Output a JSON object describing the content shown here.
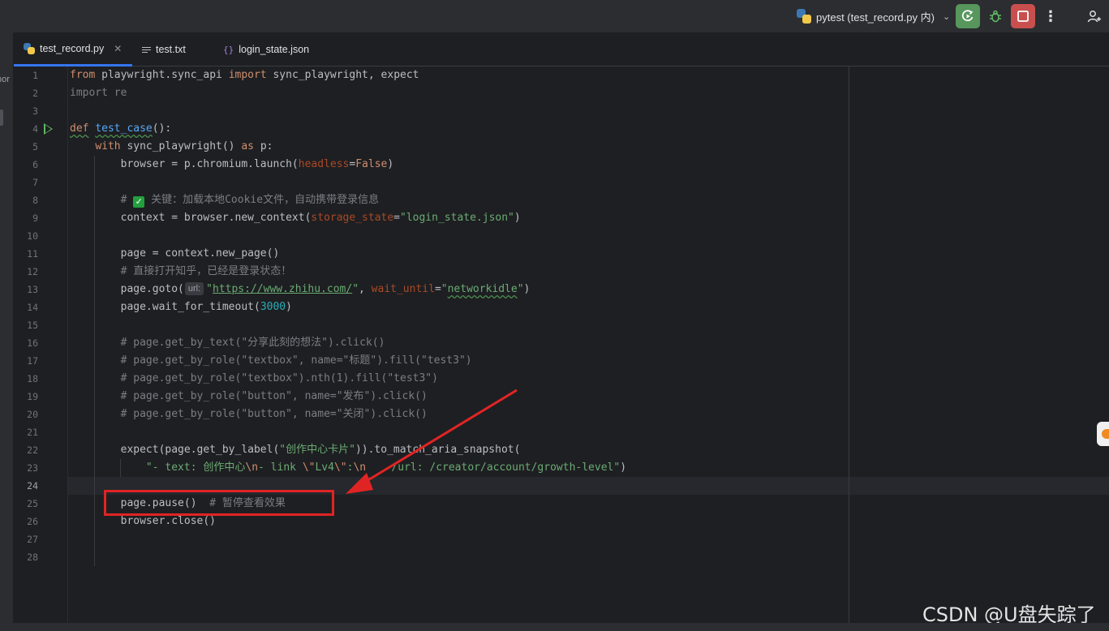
{
  "toolbar": {
    "run_config": "pytest (test_record.py 内)",
    "colors": {
      "run": "#57965c",
      "stop": "#c94f4f"
    }
  },
  "left_strip": {
    "cut_label": "nor"
  },
  "tabs": [
    {
      "label": "test_record.py",
      "active": true,
      "icon": "python-icon",
      "closable": true
    },
    {
      "label": "test.txt",
      "active": false,
      "icon": "text-file-icon"
    },
    {
      "label": "login_state.json",
      "active": false,
      "icon": "json-file-icon"
    }
  ],
  "editor": {
    "current_line": 24,
    "line_numbers": [
      "1",
      "2",
      "3",
      "4",
      "5",
      "6",
      "7",
      "8",
      "9",
      "10",
      "11",
      "12",
      "13",
      "14",
      "15",
      "16",
      "17",
      "18",
      "19",
      "20",
      "21",
      "22",
      "23",
      "24",
      "25",
      "26",
      "27",
      "28"
    ],
    "code": {
      "l1": {
        "kw1": "from",
        "mod": " playwright.sync_api ",
        "kw2": "import",
        "rest": " sync_playwright, expect"
      },
      "l2": {
        "text": "import re"
      },
      "l4": {
        "kw": "def",
        "sp": " ",
        "name": "test_case",
        "rest": "():"
      },
      "l5": {
        "indent": "    ",
        "kw": "with",
        "mid": " sync_playwright() ",
        "kw2": "as",
        "rest": " p:"
      },
      "l6": {
        "pre": "        browser = p.chromium.launch(",
        "param": "headless",
        "eq": "=",
        "val": "False",
        "post": ")"
      },
      "l8": {
        "pre": "        # ",
        "check": "✓",
        "post": " 关键：加载本地Cookie文件，自动携带登录信息"
      },
      "l9": {
        "pre": "        context = browser.new_context(",
        "param": "storage_state",
        "eq": "=",
        "str": "\"login_state.json\"",
        "post": ")"
      },
      "l11": {
        "text": "        page = context.new_page()"
      },
      "l12": {
        "text": "        # 直接打开知乎，已经是登录状态！"
      },
      "l13": {
        "pre": "        page.goto(",
        "hint": "url:",
        "q1": "\"",
        "url": "https://www.zhihu.com/",
        "q2": "\"",
        "comma": ", ",
        "param": "wait_until",
        "eq": "=",
        "q3": "\"",
        "val": "networkidle",
        "q4": "\"",
        "post": ")"
      },
      "l14": {
        "pre": "        page.wait_for_timeout(",
        "num": "3000",
        "post": ")"
      },
      "l16": {
        "text": "        # page.get_by_text(\"分享此刻的想法\").click()"
      },
      "l17": {
        "text": "        # page.get_by_role(\"textbox\", name=\"标题\").fill(\"test3\")"
      },
      "l18": {
        "text": "        # page.get_by_role(\"textbox\").nth(1).fill(\"test3\")"
      },
      "l19": {
        "text": "        # page.get_by_role(\"button\", name=\"发布\").click()"
      },
      "l20": {
        "text": "        # page.get_by_role(\"button\", name=\"关闭\").click()"
      },
      "l22": {
        "pre": "        expect(page.get_by_label(",
        "str": "\"创作中心卡片\"",
        "post": ")).to_match_aria_snapshot("
      },
      "l23": {
        "s1": "            \"- text: 创作中心",
        "e1": "\\n",
        "s2": "- link ",
        "e2": "\\\"",
        "s3": "Lv4",
        "e3": "\\\"",
        "s4": ":",
        "e4": "\\n",
        "s5": "    /url: /creator/account/growth-level\"",
        "post": ")"
      },
      "l25": {
        "code": "        page.pause()",
        "cm": "  # 暂停查看效果"
      },
      "l26": {
        "text": "        browser.close()"
      }
    }
  },
  "annotation": {
    "color": "#e02424"
  },
  "watermark": "CSDN @U盘失踪了"
}
